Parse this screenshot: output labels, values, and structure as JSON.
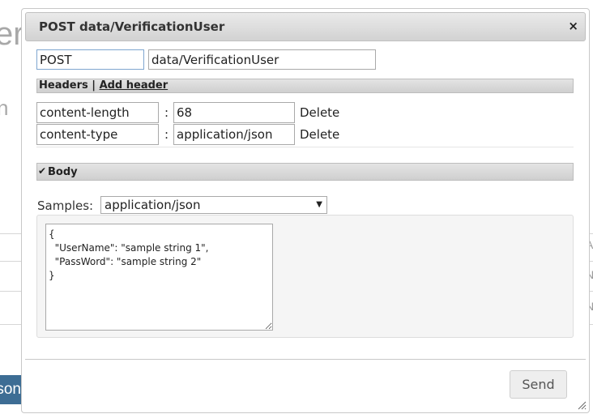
{
  "background": {
    "heading_fragment": "er",
    "text_fragment": "n",
    "button_fragment": "json",
    "right_letters": [
      "A",
      "N",
      "N"
    ]
  },
  "dialog": {
    "title": "POST data/VerificationUser",
    "close_label": "×",
    "method": "POST",
    "url": "data/VerificationUser",
    "headers_section": {
      "label": "Headers",
      "separator": "|",
      "add_link": "Add header"
    },
    "headers": [
      {
        "name": "content-length",
        "value": "68",
        "delete": "Delete"
      },
      {
        "name": "content-type",
        "value": "application/json",
        "delete": "Delete"
      }
    ],
    "colon": ":",
    "body_section": {
      "label": "Body",
      "checked": true
    },
    "samples": {
      "label": "Samples:",
      "selected": "application/json"
    },
    "body_text": "{\n  \"UserName\": \"sample string 1\",\n  \"PassWord\": \"sample string 2\"\n}",
    "send_label": "Send"
  },
  "colors": {
    "accent_button": "#3d6d94",
    "title_bar": "#dcdcdc",
    "focus_border": "#7fa6d0"
  }
}
